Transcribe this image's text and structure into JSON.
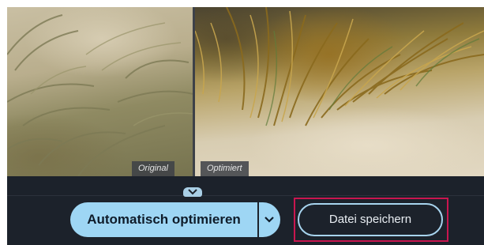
{
  "preview": {
    "original_label": "Original",
    "optimized_label": "Optimiert",
    "divider_handle_icon": "chevron-down-icon"
  },
  "toolbar": {
    "auto_optimize_label": "Automatisch optimieren",
    "auto_optimize_dropdown_icon": "chevron-down-icon",
    "save_label": "Datei speichern"
  },
  "colors": {
    "background": "#1c222b",
    "accent": "#9ed6f4",
    "highlight": "#c8164f"
  }
}
